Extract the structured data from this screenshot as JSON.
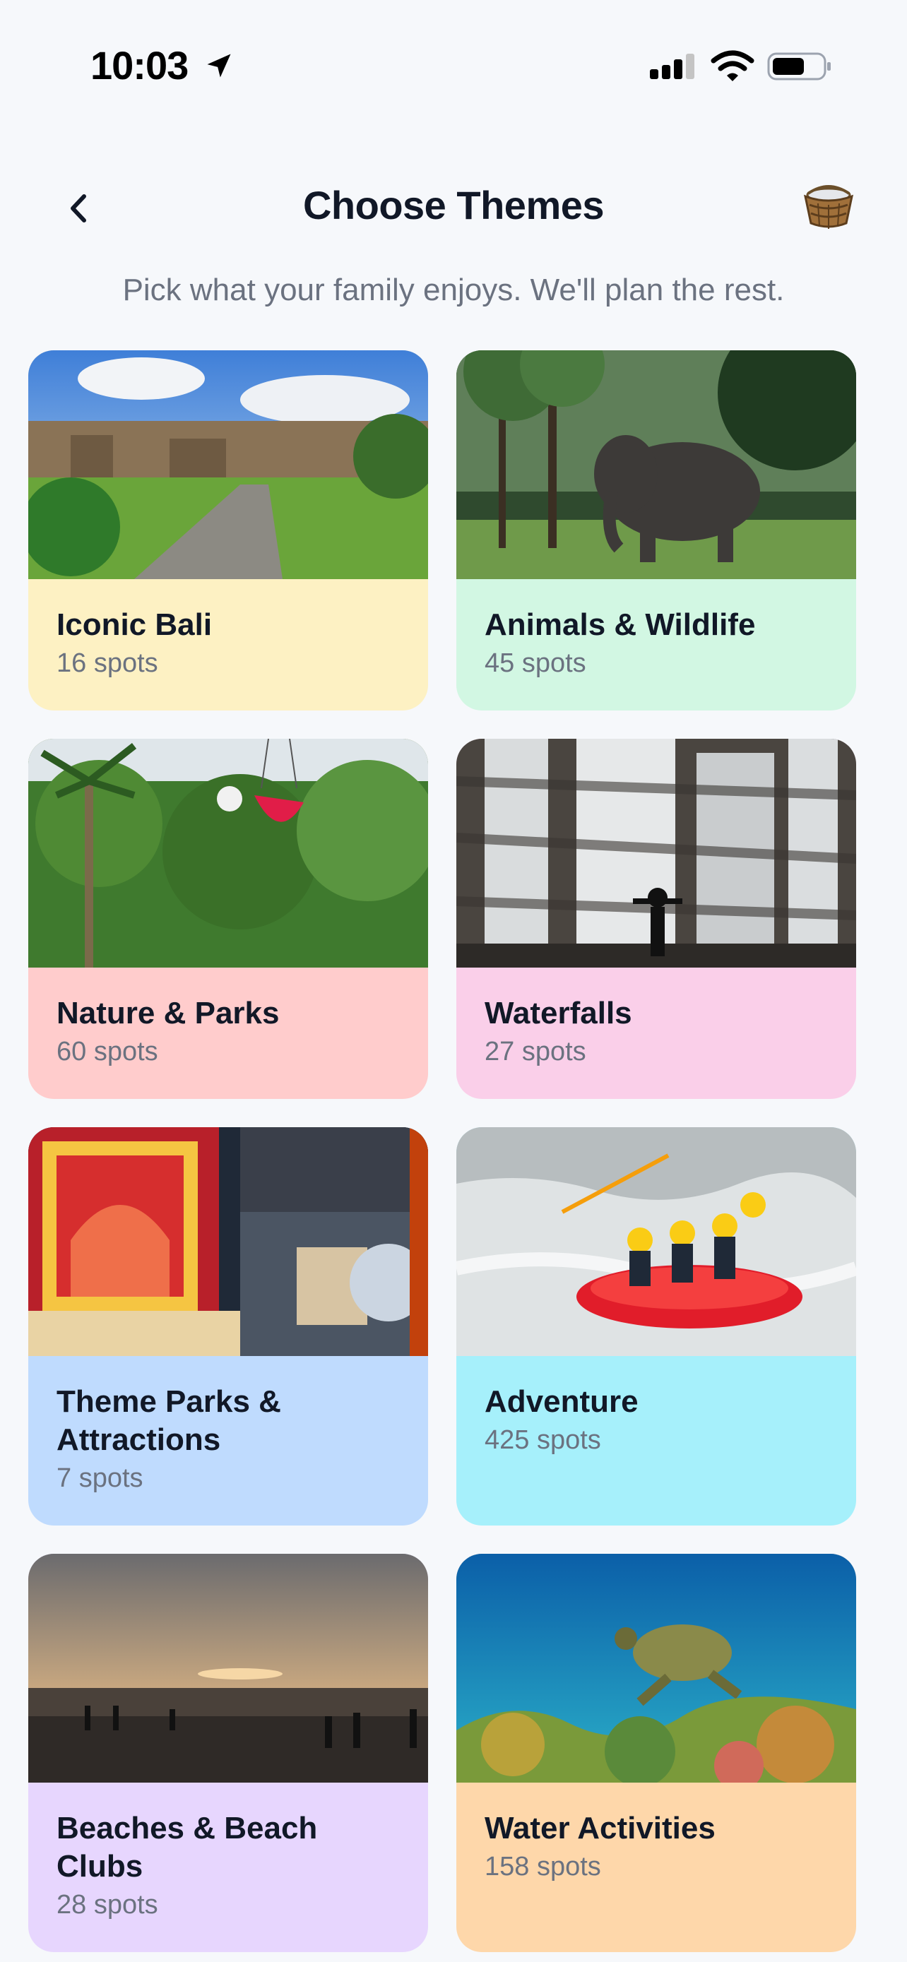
{
  "status_bar": {
    "time": "10:03",
    "icons": [
      "location-arrow-icon",
      "cellular-signal-icon",
      "wifi-icon",
      "battery-icon"
    ]
  },
  "header": {
    "title": "Choose Themes",
    "back_icon": "chevron-left-icon",
    "basket_icon": "basket-icon"
  },
  "subtitle": "Pick what your family enjoys. We'll plan the rest.",
  "themes": [
    {
      "title": "Iconic Bali",
      "count": "16 spots",
      "color": "#fdf1c3"
    },
    {
      "title": "Animals & Wildlife",
      "count": "45 spots",
      "color": "#d2f7e3"
    },
    {
      "title": "Nature & Parks",
      "count": "60 spots",
      "color": "#ffcccc"
    },
    {
      "title": "Waterfalls",
      "count": "27 spots",
      "color": "#facfe9"
    },
    {
      "title": "Theme Parks & Attractions",
      "count": "7 spots",
      "color": "#bfdbfe"
    },
    {
      "title": "Adventure",
      "count": "425 spots",
      "color": "#a6f0fb"
    },
    {
      "title": "Beaches & Beach Clubs",
      "count": "28 spots",
      "color": "#e7d6fe"
    },
    {
      "title": "Water Activities",
      "count": "158 spots",
      "color": "#fed7aa"
    }
  ]
}
